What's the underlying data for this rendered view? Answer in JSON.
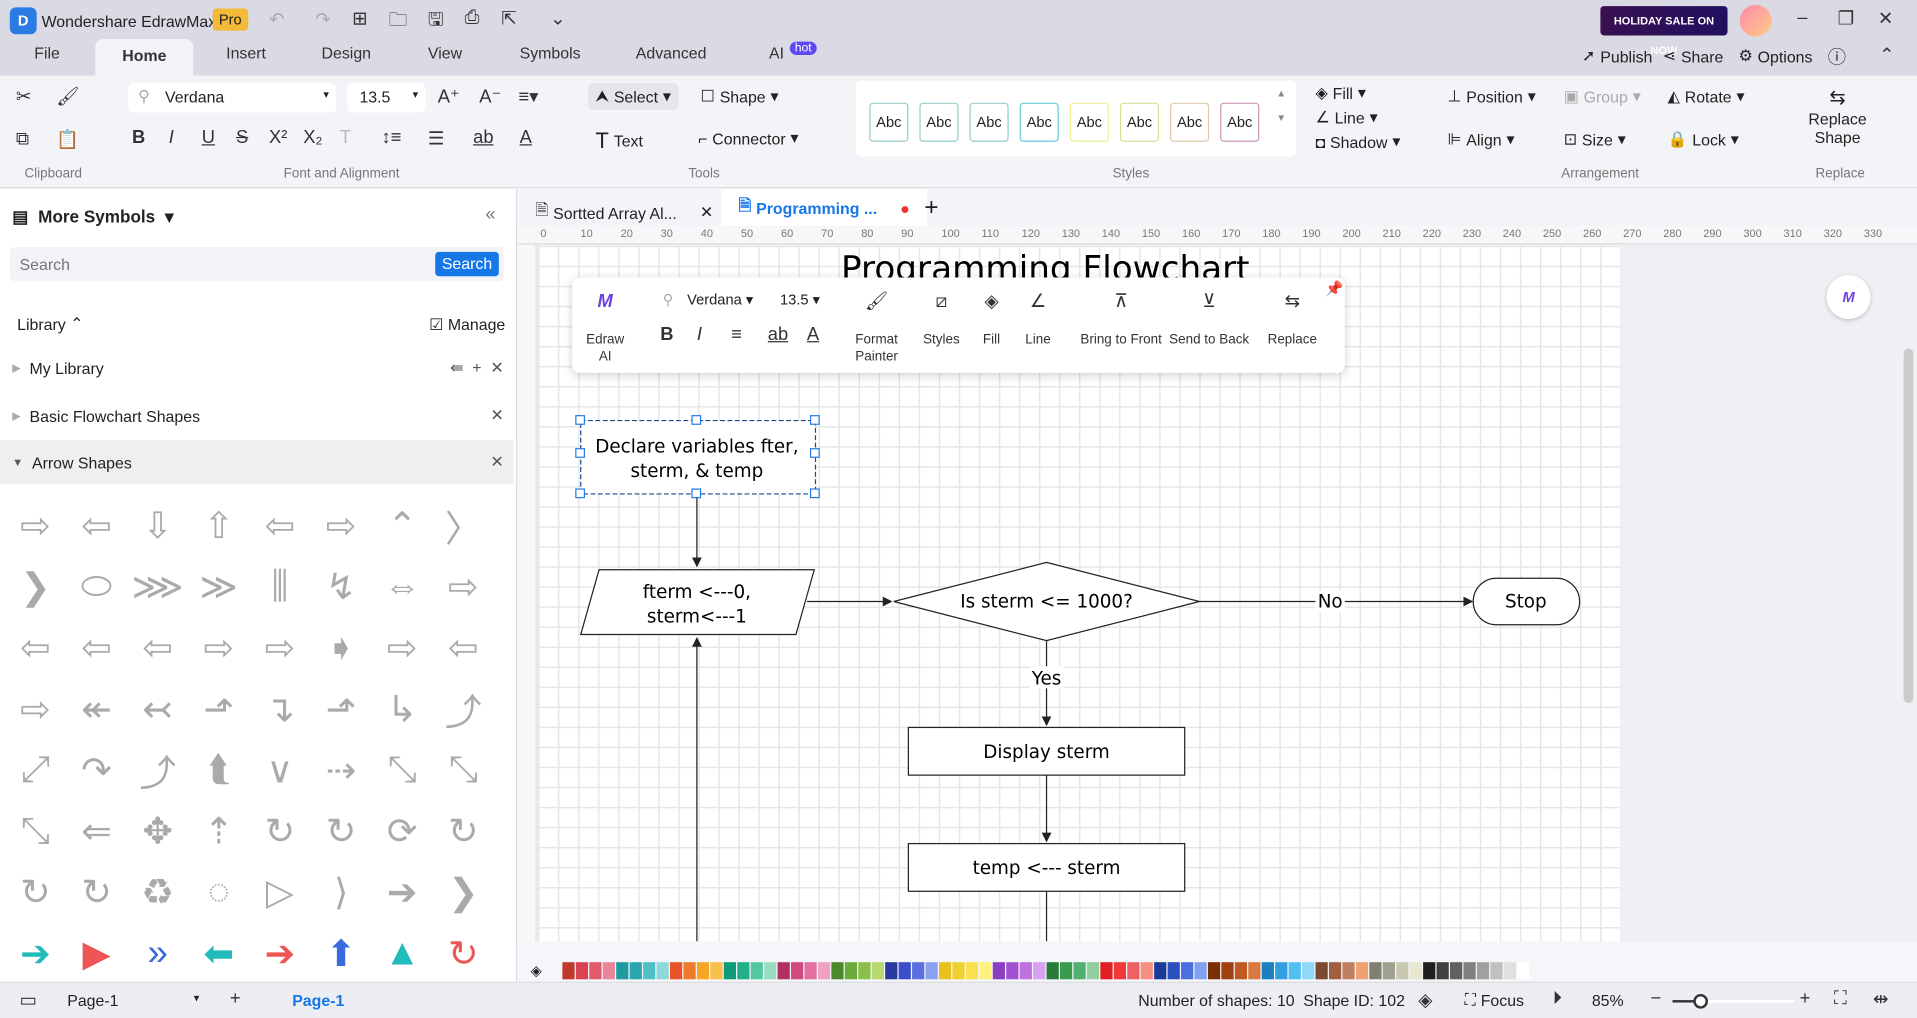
{
  "app": {
    "title": "Wondershare EdrawMax",
    "badge": "Pro",
    "promo": "HOLIDAY SALE ON NOW"
  },
  "menu": [
    "File",
    "Home",
    "Insert",
    "Design",
    "View",
    "Symbols",
    "Advanced",
    "AI"
  ],
  "ai_badge": "hot",
  "top_right": {
    "publish": "Publish",
    "share": "Share",
    "options": "Options"
  },
  "ribbon": {
    "font": "Verdana",
    "size": "13.5",
    "select": "Select",
    "shape": "Shape",
    "text": "Text",
    "connector": "Connector",
    "styles": [
      "Abc",
      "Abc",
      "Abc",
      "Abc",
      "Abc",
      "Abc",
      "Abc",
      "Abc"
    ],
    "fill": "Fill",
    "line": "Line",
    "shadow": "Shadow",
    "position": "Position",
    "group": "Group",
    "rotate": "Rotate",
    "align": "Align",
    "size_btn": "Size",
    "lock": "Lock",
    "replace_shape": "Replace Shape",
    "groups": {
      "clipboard": "Clipboard",
      "font": "Font and Alignment",
      "tools": "Tools",
      "styles": "Styles",
      "arrangement": "Arrangement",
      "replace": "Replace"
    }
  },
  "panel": {
    "title": "More Symbols",
    "search_placeholder": "Search",
    "search_btn": "Search",
    "library": "Library",
    "manage": "Manage",
    "items": [
      "My Library",
      "Basic Flowchart Shapes",
      "Arrow Shapes"
    ],
    "arrows": [
      "⇨",
      "⇦",
      "⇩",
      "⇧",
      "⇦",
      "⇨",
      "⌃",
      "〉",
      "❯",
      "⬭",
      "⋙",
      "≫",
      "⫼",
      "↯",
      "⇔",
      "⇨",
      "⇦",
      "⇦",
      "⇦",
      "⇨",
      "⇨",
      "➧",
      "⇨",
      "⇦",
      "⇨",
      "↞",
      "↢",
      "⬏",
      "↴",
      "⬏",
      "↳",
      "⤴",
      "⤢",
      "↷",
      "⤴",
      "⮬",
      "∨",
      "⇢",
      "⤡",
      "⤡",
      "⤡",
      "⇐",
      "✥",
      "⇡",
      "↻",
      "↻",
      "⟳",
      "↻",
      "↻",
      "↻",
      "♻",
      "◌",
      "▷",
      "⟩",
      "➔",
      "❯",
      "➔",
      "▶",
      "»",
      "⬅",
      "➔",
      "⬆",
      "▲",
      "↻"
    ]
  },
  "docs": {
    "tabs": [
      "Sortted Array Al...",
      "Programming ..."
    ]
  },
  "ruler": [
    "0",
    "10",
    "20",
    "30",
    "40",
    "50",
    "60",
    "70",
    "80",
    "90",
    "100",
    "110",
    "120",
    "130",
    "140",
    "150",
    "160",
    "170",
    "180",
    "190",
    "200",
    "210",
    "220",
    "230",
    "240",
    "250",
    "260",
    "270",
    "280",
    "290",
    "300",
    "310",
    "320",
    "330"
  ],
  "float": {
    "ai": "Edraw AI",
    "font": "Verdana",
    "size": "13.5",
    "format_painter": "Format Painter",
    "styles": "Styles",
    "fill": "Fill",
    "line": "Line",
    "front": "Bring to Front",
    "back": "Send to Back",
    "replace": "Replace"
  },
  "diagram": {
    "title": "Programming Flowchart",
    "declare1": "Declare variables fter,",
    "declare2": "sterm, & temp",
    "init1": "fterm <---0,",
    "init2": "sterm<---1",
    "cond": "Is sterm <= 1000?",
    "no": "No",
    "stop": "Stop",
    "yes": "Yes",
    "display": "Display sterm",
    "temp": "temp <--- sterm"
  },
  "colors": [
    "#c0392b",
    "#d9434f",
    "#e05a6a",
    "#e8879a",
    "#1e9aa0",
    "#2aa6b0",
    "#50c0c8",
    "#8ed8dc",
    "#e8552a",
    "#f07a2a",
    "#f5a623",
    "#f8c04a",
    "#0f9a7a",
    "#22b08a",
    "#55c7a0",
    "#9bdcc0",
    "#b03060",
    "#d04a80",
    "#e070a0",
    "#f0a0c0",
    "#4a8a2a",
    "#6aaa3a",
    "#8ac04a",
    "#b8d870",
    "#2a3aa0",
    "#3a50c8",
    "#5a70e0",
    "#8aa0f0",
    "#e8c020",
    "#f0d030",
    "#f8e050",
    "#fff080",
    "#8a40c0",
    "#a050d0",
    "#c070e0",
    "#d8a0f0",
    "#2a7a3a",
    "#3a9a50",
    "#50b070",
    "#90d0a0",
    "#e02020",
    "#f03a3a",
    "#f06060",
    "#f89080",
    "#1a3a9a",
    "#2a50c0",
    "#4a70e0",
    "#80a0f0",
    "#7a3000",
    "#a04010",
    "#c05a20",
    "#d87a40",
    "#1a80c0",
    "#30a0e0",
    "#50c0f0",
    "#90d8f8",
    "#7a4a30",
    "#a06040",
    "#c08060",
    "#f0a070",
    "#808070",
    "#a0a090",
    "#c8c8b0",
    "#e8e8d0",
    "#202020",
    "#404040",
    "#606060",
    "#808080",
    "#a0a0a0",
    "#c0c0c0",
    "#e0e0e0",
    "#ffffff"
  ],
  "status": {
    "page_sel": "Page-1",
    "page_tab": "Page-1",
    "shapes": "Number of shapes: 10",
    "shape_id": "Shape ID: 102",
    "focus": "Focus",
    "zoom": "85%",
    "zoom_level": 85
  }
}
